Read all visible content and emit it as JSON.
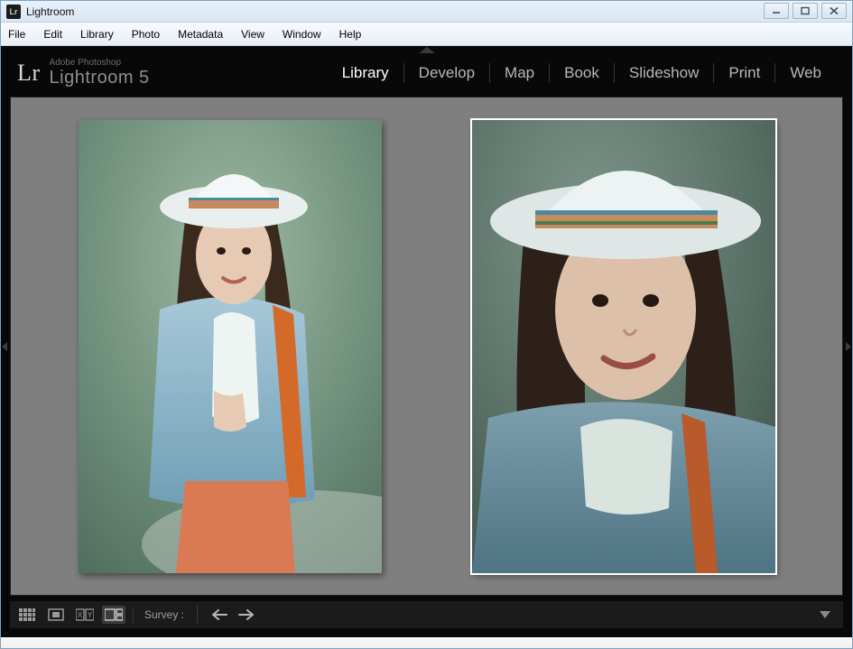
{
  "window": {
    "appIconText": "Lr",
    "title": "Lightroom"
  },
  "menu": {
    "items": [
      "File",
      "Edit",
      "Library",
      "Photo",
      "Metadata",
      "View",
      "Window",
      "Help"
    ]
  },
  "branding": {
    "mark": "Lr",
    "top": "Adobe Photoshop",
    "bottom": "Lightroom 5"
  },
  "modules": {
    "items": [
      "Library",
      "Develop",
      "Map",
      "Book",
      "Slideshow",
      "Print",
      "Web"
    ],
    "activeIndex": 0
  },
  "toolbar": {
    "label": "Survey :"
  },
  "photos": [
    {
      "selected": false,
      "alt": "Portrait photo 1"
    },
    {
      "selected": true,
      "alt": "Portrait photo 2"
    }
  ]
}
